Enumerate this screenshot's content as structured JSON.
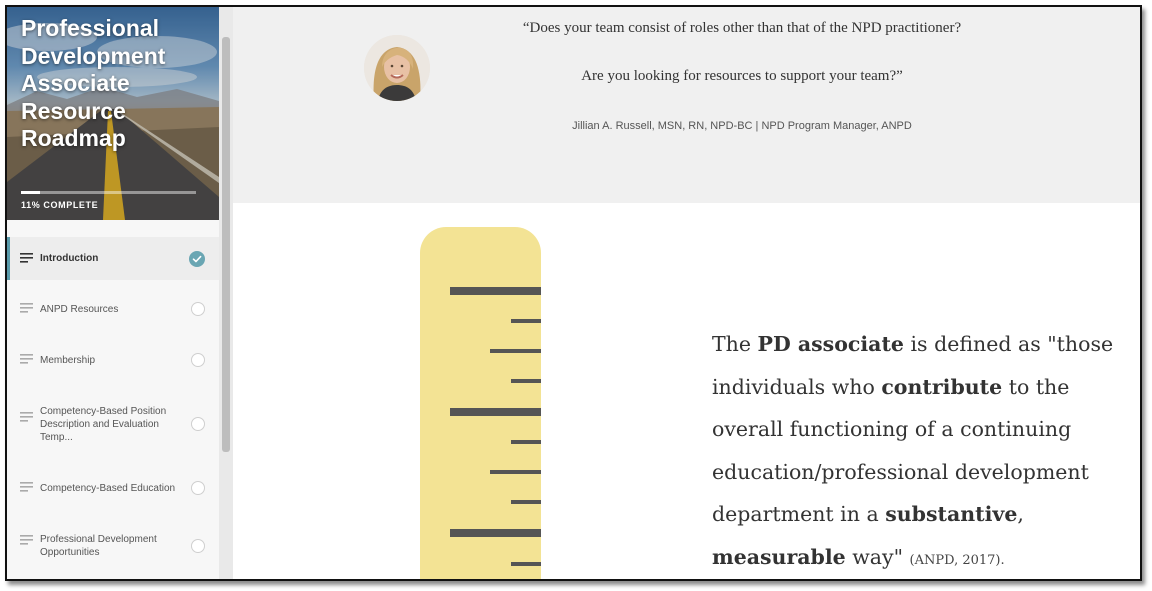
{
  "sidebar": {
    "title": "Professional\nDevelopment\nAssociate\nResource\nRoadmap",
    "progress_percent": 11,
    "progress_label": "11% COMPLETE",
    "items": [
      {
        "label": "Introduction",
        "status": "complete"
      },
      {
        "label": "ANPD Resources",
        "status": "incomplete"
      },
      {
        "label": "Membership",
        "status": "incomplete"
      },
      {
        "label": "Competency-Based Position Description and Evaluation Temp...",
        "status": "incomplete"
      },
      {
        "label": "Competency-Based Education",
        "status": "incomplete"
      },
      {
        "label": "Professional Development Opportunities",
        "status": "incomplete"
      }
    ]
  },
  "quote": {
    "line1": "“Does your team consist of roles other than that of the NPD practitioner?",
    "line2": "Are you looking for resources to support your team?”",
    "attribution": "Jillian A. Russell, MSN, RN, NPD-BC  |  NPD Program Manager, ANPD"
  },
  "definition": {
    "p1": "The ",
    "b1": "PD associate",
    "p2": " is defined as \"those individuals who ",
    "b2": "contribute",
    "p3": " to the overall functioning of a continuing education/professional development department in a ",
    "b3": "substantive",
    "p4": ", ",
    "b4": "measurable",
    "p5": " way\" ",
    "citation": "(ANPD, 2017)."
  },
  "icons": {
    "list": "lines-icon",
    "check": "check-icon",
    "status_empty": "empty-circle-icon"
  },
  "colors": {
    "accent": "#6aa6b3",
    "ruler_fill": "#f3e394",
    "ruler_ticks": "#555555",
    "quote_band": "#f0f0f0"
  }
}
